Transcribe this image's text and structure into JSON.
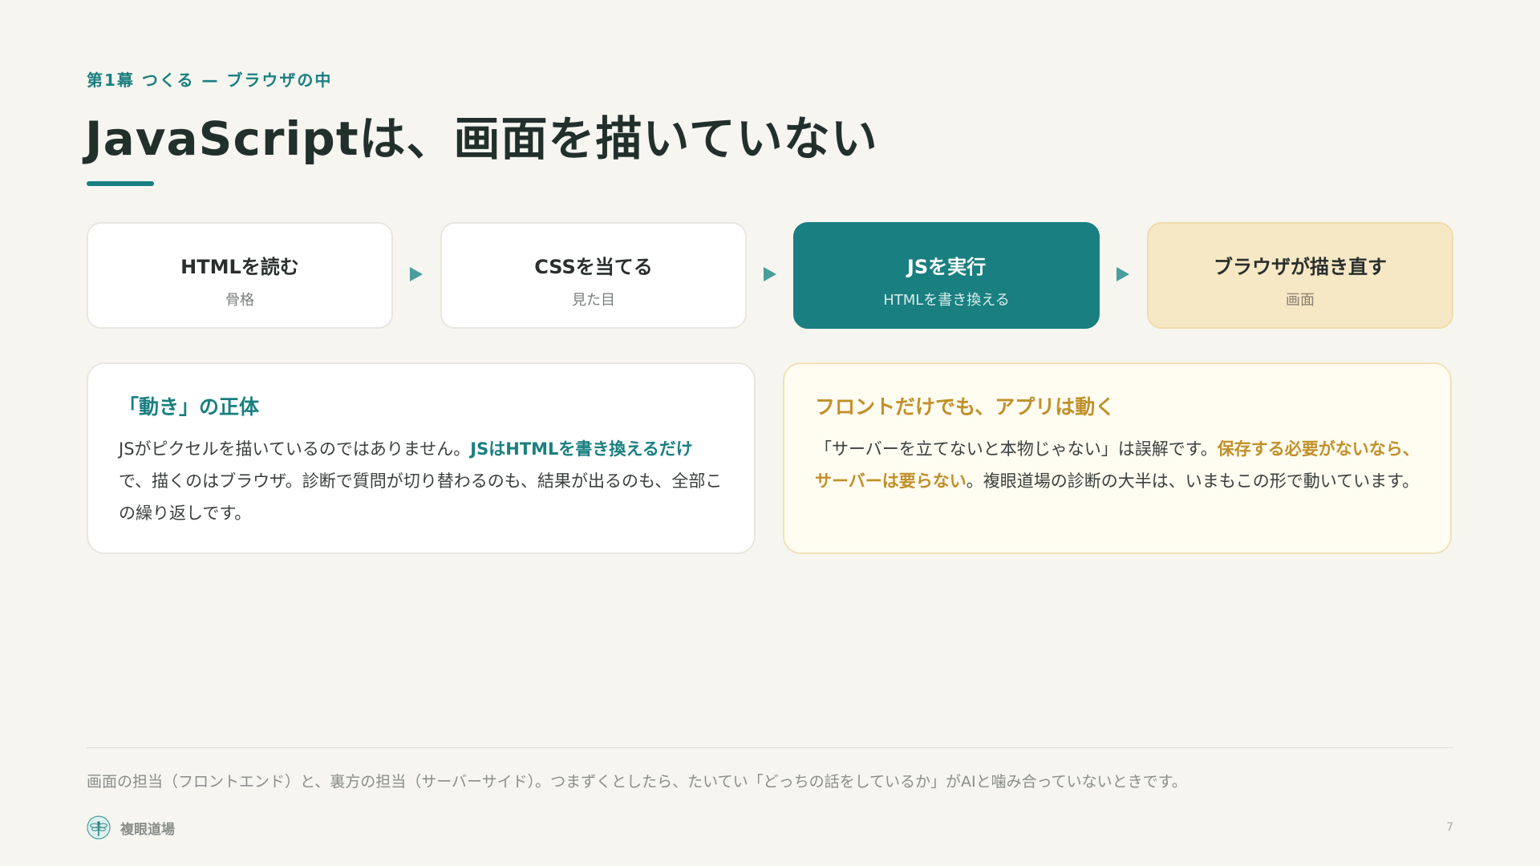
{
  "header": {
    "eyebrow": "第1幕 つくる — ブラウザの中",
    "title": "JavaScriptは、画面を描いていない"
  },
  "flow": {
    "steps": [
      {
        "title": "HTMLを読む",
        "sub": "骨格"
      },
      {
        "title": "CSSを当てる",
        "sub": "見た目"
      },
      {
        "title": "JSを実行",
        "sub": "HTMLを書き換える"
      },
      {
        "title": "ブラウザが描き直す",
        "sub": "画面"
      }
    ]
  },
  "cards": {
    "left": {
      "title": "「動き」の正体",
      "body_a": "JSがピクセルを描いているのではありません。",
      "body_hl": "JSはHTMLを書き換えるだけ",
      "body_b": "で、描くのはブラウザ。診断で質問が切り替わるのも、結果が出るのも、全部この繰り返しです。"
    },
    "right": {
      "title": "フロントだけでも、アプリは動く",
      "body_a": "「サーバーを立てないと本物じゃない」は誤解です。",
      "body_hl": "保存する必要がないなら、サーバーは要らない",
      "body_b": "。複眼道場の診断の大半は、いまもこの形で動いています。"
    }
  },
  "footer": {
    "note": "画面の担当（フロントエンド）と、裏方の担当（サーバーサイド）。つまずくとしたら、たいてい「どっちの話をしているか」がAIと噛み合っていないときです。",
    "brand": "複眼道場",
    "page": "7"
  },
  "colors": {
    "accent": "#1a7f80",
    "warm": "#c0902a",
    "background": "#f6f5f0"
  },
  "icons": {
    "brand": "dragonfly-icon",
    "arrow": "triangle-right-icon"
  }
}
